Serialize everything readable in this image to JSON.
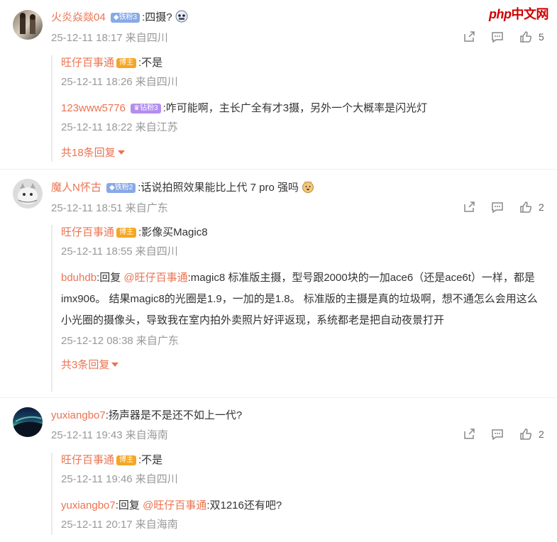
{
  "watermark": {
    "php": "php",
    "cn": "中文网"
  },
  "comments": [
    {
      "user": "火炎焱燚04",
      "badge": "铁粉3",
      "text": ":四摄?",
      "meta": "25-12-11 18:17 来自四川",
      "likes": "5",
      "replies": [
        {
          "user": "旺仔百事通",
          "badge": "博主",
          "text": ":不是",
          "meta": "25-12-11 18:26 来自四川"
        },
        {
          "user": "123www5776",
          "badge": "钻粉3",
          "text": ":咋可能啊，主长广全有才3摄，另外一个大概率是闪光灯",
          "meta": "25-12-11 18:22 来自江苏"
        }
      ],
      "more": "共18条回复"
    },
    {
      "user": "魔人N怀古",
      "badge": "铁粉2",
      "text": ":话说拍照效果能比上代 7 pro 强吗",
      "meta": "25-12-11 18:51 来自广东",
      "likes": "2",
      "replies": [
        {
          "user": "旺仔百事通",
          "badge": "博主",
          "text": ":影像买Magic8",
          "meta": "25-12-11 18:55 来自四川"
        },
        {
          "user": "bduhdb",
          "reply_prefix": ":回复",
          "mention": "@旺仔百事通",
          "text": ":magic8 标准版主摄，型号跟2000块的一加ace6（还是ace6t）一样，都是imx906。 结果magic8的光圈是1.9，一加的是1.8。 标准版的主摄是真的垃圾啊，想不通怎么会用这么小光圈的摄像头，导致我在室内拍外卖照片好评返现，系统都老是把自动夜景打开",
          "meta": "25-12-12 08:38 来自广东"
        }
      ],
      "more": "共3条回复"
    },
    {
      "user": "yuxiangbo7",
      "text": ":扬声器是不是还不如上一代?",
      "meta": "25-12-11 19:43 来自海南",
      "likes": "2",
      "replies": [
        {
          "user": "旺仔百事通",
          "badge": "博主",
          "text": ":不是",
          "meta": "25-12-11 19:46 来自四川"
        },
        {
          "user": "yuxiangbo7",
          "reply_prefix": ":回复",
          "mention": "@旺仔百事通",
          "text": ":双1216还有吧?",
          "meta": "25-12-11 20:17 来自海南"
        }
      ]
    }
  ]
}
